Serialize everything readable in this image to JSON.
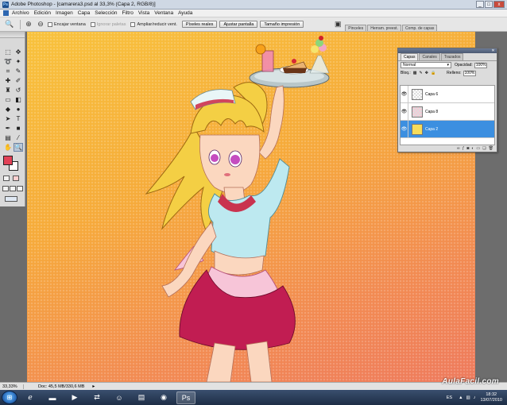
{
  "window": {
    "title": "Adobe Photoshop - [camarera3.psd al 33,3% (Capa 2, RGB/8)]",
    "buttons": [
      "_",
      "□",
      "x"
    ]
  },
  "menubar": {
    "items": [
      "Archivo",
      "Edición",
      "Imagen",
      "Capa",
      "Selección",
      "Filtro",
      "Vista",
      "Ventana",
      "Ayuda"
    ]
  },
  "options": {
    "checkboxes": [
      {
        "label": "Encajar ventana",
        "enabled": true
      },
      {
        "label": "Ignorar paletas",
        "enabled": false
      },
      {
        "label": "Ampliar/reducir vent.",
        "enabled": true
      }
    ],
    "buttons": [
      "Píxeles reales",
      "Ajustar pantalla",
      "Tamaño impresión"
    ],
    "well_tabs": [
      "Pinceles",
      "Herram. preest.",
      "Comp. de capas"
    ]
  },
  "colors": {
    "foreground": "#e24257",
    "background": "#ffffff",
    "selection": "#3c8fe0"
  },
  "layers_panel": {
    "tabs": [
      "Capas",
      "Canales",
      "Trazados"
    ],
    "blend_mode": "Normal",
    "opacity_label": "Opacidad:",
    "opacity_value": "100%",
    "lock_label": "Bloq.:",
    "fill_label": "Relleno:",
    "fill_value": "100%",
    "layers": [
      {
        "name": "Capa 6",
        "visible": true,
        "selected": false
      },
      {
        "name": "Capa 8",
        "visible": true,
        "selected": false
      },
      {
        "name": "Capa 2",
        "visible": true,
        "selected": true
      }
    ]
  },
  "status": {
    "zoom": "33,33%",
    "doc": "Doc: 45,5 MB/330,6 MB"
  },
  "taskbar": {
    "language": "ES",
    "time": "18:32",
    "date": "13/07/2010",
    "watermark": "AulaFacil.com"
  }
}
